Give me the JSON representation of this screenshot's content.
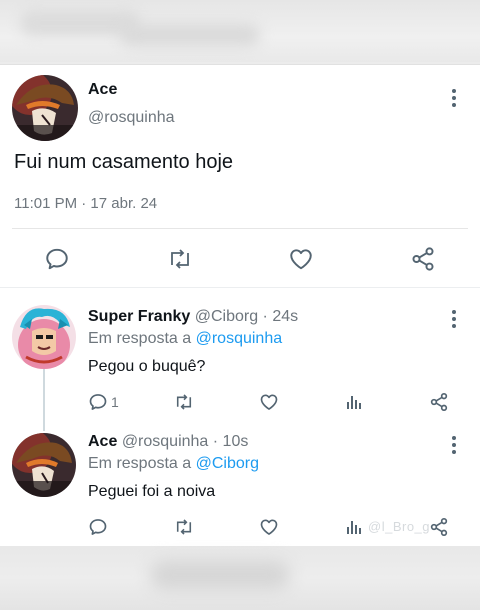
{
  "main_tweet": {
    "display_name": "Ace",
    "handle": "@rosquinha",
    "text": "Fui num casamento hoje",
    "timestamp": "11:01 PM · 17 abr. 24",
    "actions": [
      "reply-icon",
      "retweet-icon",
      "like-icon",
      "share-icon"
    ]
  },
  "replies": [
    {
      "display_name": "Super Franky",
      "handle": "@Ciborg",
      "age": "· 24s",
      "reply_prefix": "Em resposta a ",
      "reply_to": "@rosquinha",
      "text": "Pegou o buquê?",
      "reply_count": "1"
    },
    {
      "display_name": "Ace",
      "handle": "@rosquinha",
      "age": "· 10s",
      "reply_prefix": "Em resposta a ",
      "reply_to": "@Ciborg",
      "text": "Peguei foi a noiva",
      "reply_count": ""
    }
  ],
  "watermark": "@l_Bro_g",
  "colors": {
    "accent": "#1d9bf0",
    "muted": "#6e767d",
    "icon": "#536471"
  }
}
